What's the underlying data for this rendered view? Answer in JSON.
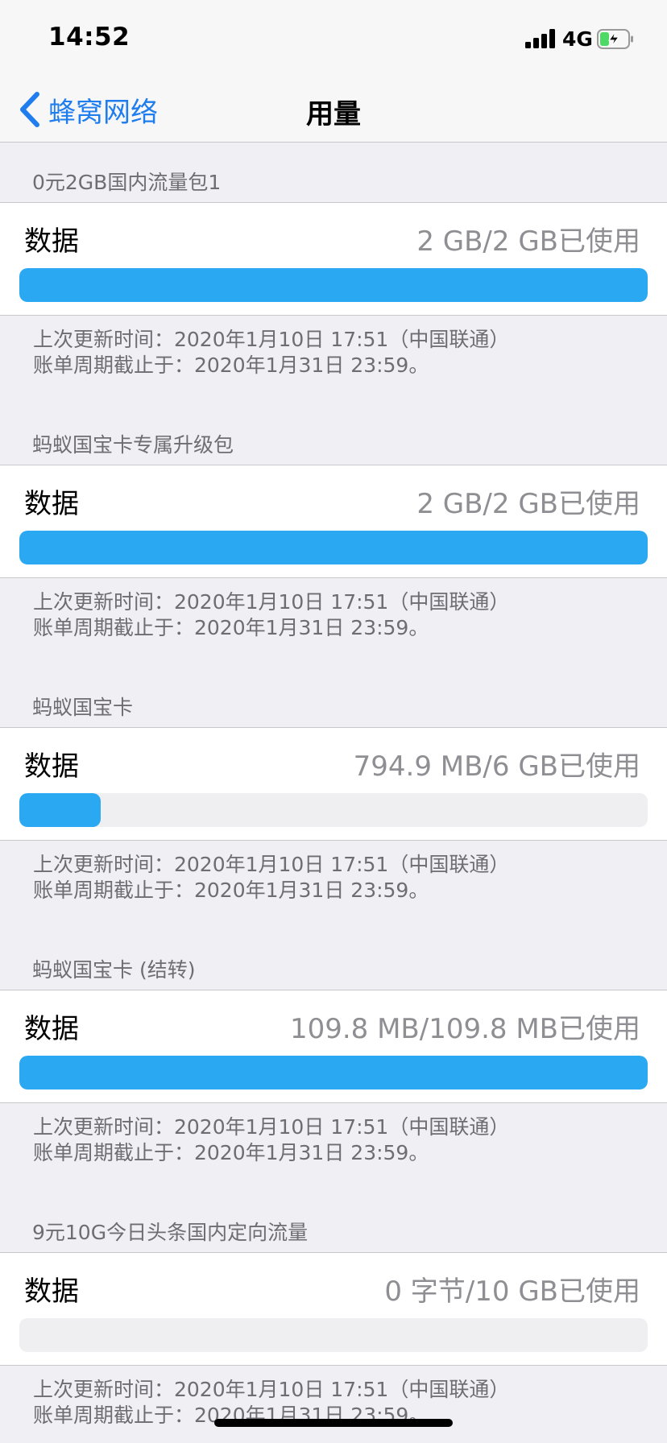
{
  "status_bar": {
    "time": "14:52",
    "network": "4G",
    "icons": [
      "signal-bars-icon",
      "battery-charging-icon"
    ]
  },
  "nav": {
    "back_label": "蜂窝网络",
    "title": "用量",
    "accent_color": "#1f7ded"
  },
  "progress_color": "#2aa8f2",
  "plans": [
    {
      "header": "0元2GB国内流量包1",
      "label": "数据",
      "usage": "2 GB/2 GB已使用",
      "used_fraction": 1.0,
      "updated": "上次更新时间：2020年1月10日 17:51（中国联通）",
      "cycle_end": "账单周期截止于：2020年1月31日 23:59。"
    },
    {
      "header": "蚂蚁国宝卡专属升级包",
      "label": "数据",
      "usage": "2 GB/2 GB已使用",
      "used_fraction": 1.0,
      "updated": "上次更新时间：2020年1月10日 17:51（中国联通）",
      "cycle_end": "账单周期截止于：2020年1月31日 23:59。"
    },
    {
      "header": "蚂蚁国宝卡",
      "label": "数据",
      "usage": "794.9 MB/6 GB已使用",
      "used_fraction": 0.129,
      "updated": "上次更新时间：2020年1月10日 17:51（中国联通）",
      "cycle_end": "账单周期截止于：2020年1月31日 23:59。"
    },
    {
      "header": "蚂蚁国宝卡 (结转)",
      "label": "数据",
      "usage": "109.8 MB/109.8 MB已使用",
      "used_fraction": 1.0,
      "updated": "上次更新时间：2020年1月10日 17:51（中国联通）",
      "cycle_end": "账单周期截止于：2020年1月31日 23:59。"
    },
    {
      "header": "9元10G今日头条国内定向流量",
      "label": "数据",
      "usage": "0 字节/10 GB已使用",
      "used_fraction": 0.0,
      "updated": "上次更新时间：2020年1月10日 17:51（中国联通）",
      "cycle_end": "账单周期截止于：2020年1月31日 23:59。"
    }
  ]
}
